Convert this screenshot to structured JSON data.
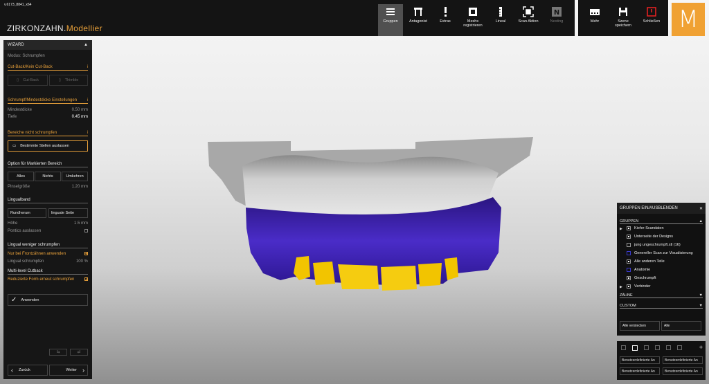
{
  "version": "v.6173_8841_x64",
  "brand": {
    "name": "ZIRKONZAHN.",
    "accent": "Modellier",
    "logo_letter": "M"
  },
  "toolbar": [
    {
      "label": "Gruppen",
      "icon": "menu-icon",
      "active": true
    },
    {
      "label": "Antagonist",
      "icon": "antagonist-icon"
    },
    {
      "label": "Extras",
      "icon": "exclamation-icon"
    },
    {
      "label": "Meshs registrieren",
      "icon": "mesh-register-icon"
    },
    {
      "label": "Lineal",
      "icon": "ruler-icon"
    },
    {
      "label": "Scan Aktion",
      "icon": "scan-icon"
    },
    {
      "label": "Nesting",
      "icon": "nesting-icon",
      "disabled": true
    }
  ],
  "right_toolbar": [
    {
      "label": "Mehr",
      "icon": "more-icon"
    },
    {
      "label": "Szene speichern",
      "icon": "save-icon"
    },
    {
      "label": "Schließen",
      "icon": "power-icon"
    }
  ],
  "wizard": {
    "title": "WIZARD",
    "mode": "Modus: Schrumpfen",
    "cutback_section": "Cut-Back/Kein Cut-Back",
    "cutback_btn": "Cut-Back",
    "thimble_btn": "Thimble",
    "shrink_section": "Schrumpf/Mindestdicke Einstellungen",
    "min_thickness_label": "Mindestdicke",
    "min_thickness_value": "0.50",
    "min_thickness_unit": "mm",
    "depth_label": "Tiefe",
    "depth_value": "0.45",
    "depth_unit": "mm",
    "no_shrink_section": "Bereiche nicht schrumpfen",
    "exclude_btn": "Bestimmte Stellen auslassen",
    "option_section": "Option für Markierten Bereich",
    "all_btn": "Alles",
    "none_btn": "Nichts",
    "invert_btn": "Umkehren",
    "brush_label": "Pinselgröße",
    "brush_value": "1.20",
    "brush_unit": "mm",
    "lingual_section": "Lingualband",
    "around_btn": "Rundherum",
    "lingual_btn": "linguale Seite",
    "height_label": "Höhe",
    "height_value": "1.5",
    "height_unit": "mm",
    "pontics_label": "Pontics auslassen",
    "pontics_checked": false,
    "lingual_less_section": "Lingual weniger schrumpfen",
    "front_only_label": "Nur bei Frontzähnen anwenden",
    "front_only_checked": true,
    "lingual_shrink_label": "Lingual schrumpfen",
    "lingual_shrink_value": "100",
    "lingual_shrink_unit": "%",
    "multilevel_section": "Multi-level Cutback",
    "reduced_label": "Reduzierte Form erneut schrumpfen",
    "reduced_checked": true,
    "apply_btn": "Anwenden",
    "back_btn": "Zurück",
    "next_btn": "Weiter"
  },
  "groups_panel": {
    "title": "GRUPPEN EIN/AUSBLENDEN",
    "section": "GRUPPEN",
    "items": [
      {
        "label": "Kiefer-Scandaten",
        "expandable": true,
        "box": "filled"
      },
      {
        "label": "Unterseite der Designs",
        "box": "filled"
      },
      {
        "label": "jung ungeschrumpft.stl (16)",
        "box": "empty"
      },
      {
        "label": "Genereller Scan zur Visualisierung",
        "box": "empty-blue"
      },
      {
        "label": "Alle anderen Teile",
        "box": "filled"
      },
      {
        "label": "Anatomie",
        "box": "empty-blue"
      },
      {
        "label": "Geschrumpft",
        "box": "filled"
      },
      {
        "label": "Verbinder",
        "expandable": true,
        "box": "filled"
      }
    ],
    "teeth_section": "ZÄHNE",
    "custom_section": "CUSTOM",
    "hide_all_btn": "Alle verstecken",
    "all_btn": "Alle"
  },
  "custom_views": [
    "Benutzerdefinierte An",
    "Benutzerdefinierte An",
    "Benutzerdefinierte An",
    "Benutzerdefinierte An"
  ],
  "colors": {
    "accent": "#f0a133",
    "teeth_blue": "#3a1fa8",
    "teeth_yellow": "#f2c400",
    "model_gray": "#bdbdbd"
  }
}
